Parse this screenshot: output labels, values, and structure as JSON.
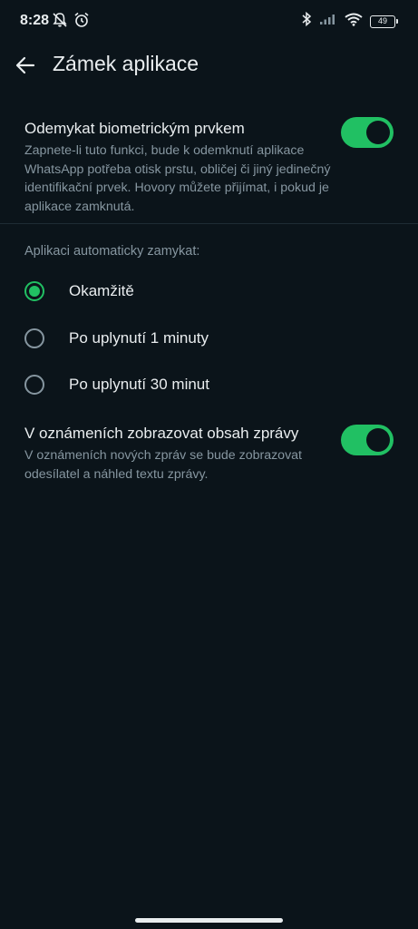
{
  "status_bar": {
    "time": "8:28",
    "battery": "49"
  },
  "app_bar": {
    "title": "Zámek aplikace"
  },
  "biometric": {
    "title": "Odemykat biometrickým prvkem",
    "description": "Zapnete-li tuto funkci, bude k odemknutí aplikace WhatsApp potřeba otisk prstu, obličej či jiný jedinečný identifikační prvek. Hovory můžete přijímat, i pokud je aplikace zamknutá.",
    "enabled": true
  },
  "auto_lock": {
    "header": "Aplikaci automaticky zamykat:",
    "options": [
      {
        "label": "Okamžitě",
        "selected": true
      },
      {
        "label": "Po uplynutí 1 minuty",
        "selected": false
      },
      {
        "label": "Po uplynutí 30 minut",
        "selected": false
      }
    ]
  },
  "notifications": {
    "title": "V oznámeních zobrazovat obsah zprávy",
    "description": "V oznámeních nových zpráv se bude zobrazovat odesílatel a náhled textu zprávy.",
    "enabled": true
  },
  "colors": {
    "background": "#0b141a",
    "accent": "#21c063",
    "text_primary": "#e9edef",
    "text_secondary": "#8696a0"
  },
  "icons": {
    "status_left": [
      "mute-notifications-icon",
      "alarm-icon"
    ],
    "status_right": [
      "bluetooth-icon",
      "signal-icon",
      "wifi-icon",
      "battery-icon"
    ],
    "back": "back-arrow-icon"
  }
}
